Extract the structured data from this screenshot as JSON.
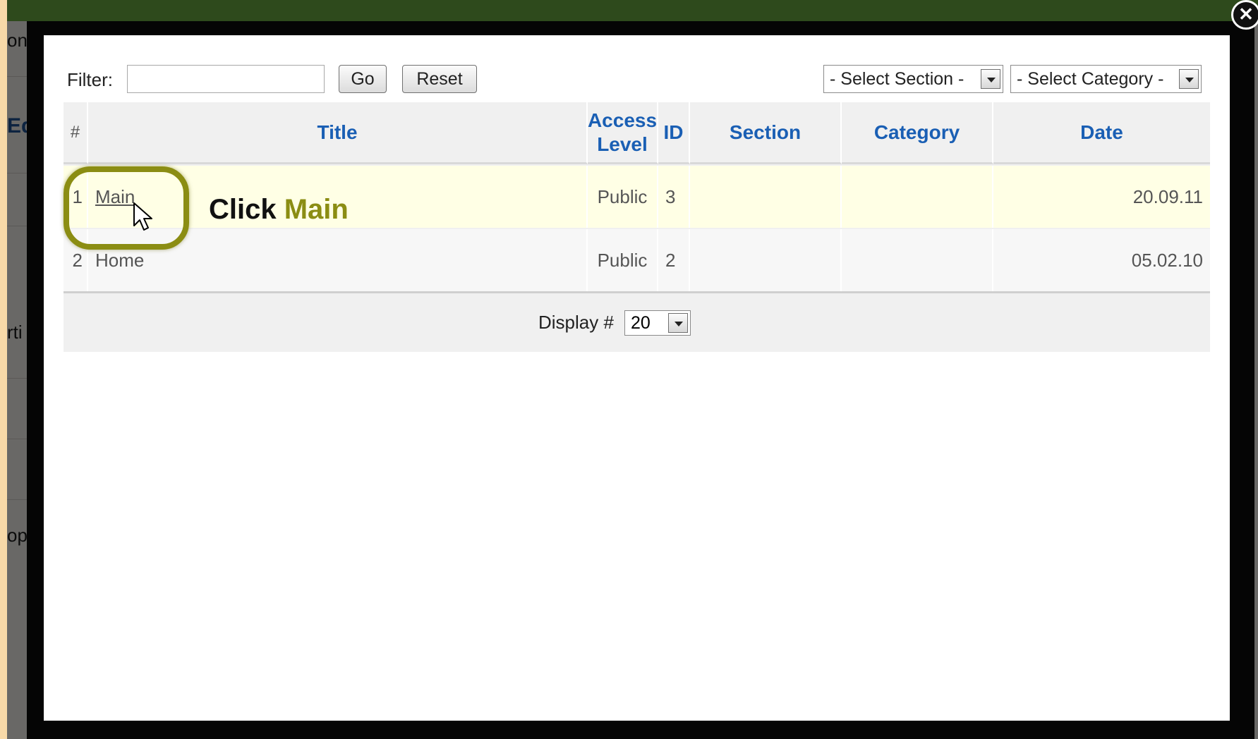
{
  "background": {
    "fragments": [
      "on",
      "Ed",
      "rti",
      "op"
    ]
  },
  "modal": {
    "close_glyph": "✕",
    "filter": {
      "label": "Filter:",
      "value": "",
      "go_label": "Go",
      "reset_label": "Reset"
    },
    "selects": {
      "section": "- Select Section -",
      "category": "- Select Category -"
    },
    "table": {
      "columns": [
        "#",
        "Title",
        "Access Level",
        "ID",
        "Section",
        "Category",
        "Date"
      ],
      "rows": [
        {
          "num": "1",
          "title": "Main",
          "access": "Public",
          "id": "3",
          "section": "",
          "category": "",
          "date": "20.09.11"
        },
        {
          "num": "2",
          "title": "Home",
          "access": "Public",
          "id": "2",
          "section": "",
          "category": "",
          "date": "05.02.10"
        }
      ],
      "display_label": "Display #",
      "display_value": "20"
    }
  },
  "annotation": {
    "prefix": "Click",
    "target": "Main",
    "color": "#8b8d13"
  },
  "colors": {
    "header_text": "#1a5fb4",
    "highlight_row": "#ffffe5",
    "top_bar": "#2e4a1c",
    "outer_background": "#f7d9a8"
  }
}
